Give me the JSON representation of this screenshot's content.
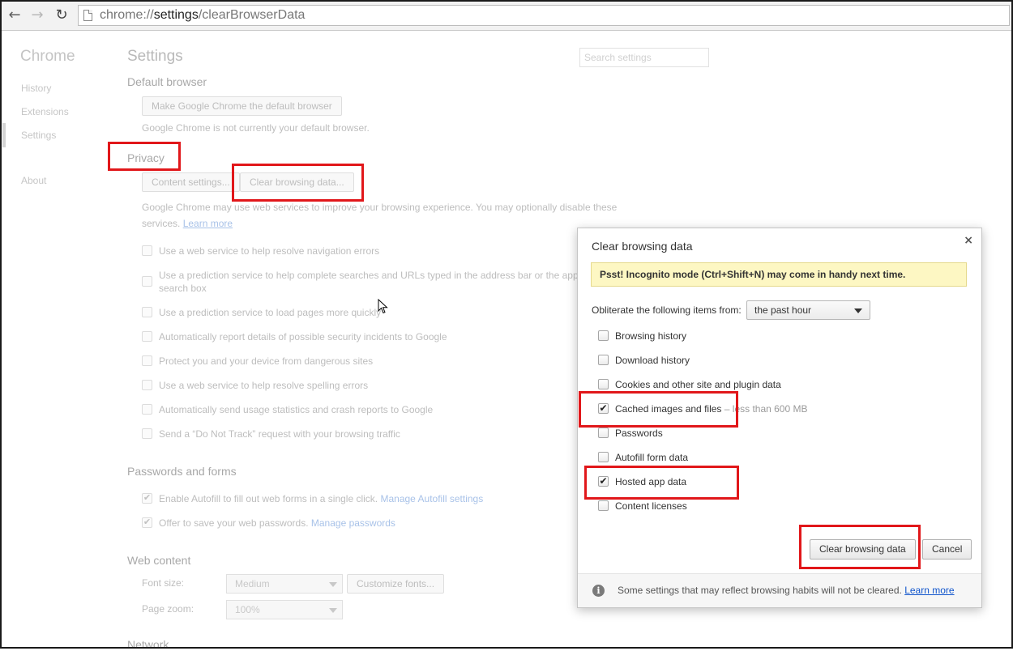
{
  "browser": {
    "url_scheme": "chrome://",
    "url_host": "settings",
    "url_path": "/clearBrowserData"
  },
  "sidebar": {
    "brand": "Chrome",
    "items": [
      {
        "label": "History"
      },
      {
        "label": "Extensions"
      },
      {
        "label": "Settings"
      },
      {
        "label": "About"
      }
    ]
  },
  "settings": {
    "title": "Settings",
    "search_placeholder": "Search settings",
    "default_browser": {
      "heading": "Default browser",
      "button": "Make Google Chrome the default browser",
      "status": "Google Chrome is not currently your default browser."
    },
    "privacy": {
      "heading": "Privacy",
      "content_settings_button": "Content settings...",
      "clear_button": "Clear browsing data...",
      "description_line1": "Google Chrome may use web services to improve your browsing experience. You may optionally disable these",
      "description_line2": "services.",
      "learn_more": "Learn more",
      "options": [
        {
          "label": "Use a web service to help resolve navigation errors",
          "checked": false
        },
        {
          "label": "Use a prediction service to help complete searches and URLs typed in the address bar or the app",
          "label2": "search box",
          "checked": false
        },
        {
          "label": "Use a prediction service to load pages more quickly",
          "checked": false
        },
        {
          "label": "Automatically report details of possible security incidents to Google",
          "checked": false
        },
        {
          "label": "Protect you and your device from dangerous sites",
          "checked": false
        },
        {
          "label": "Use a web service to help resolve spelling errors",
          "checked": false
        },
        {
          "label": "Automatically send usage statistics and crash reports to Google",
          "checked": false
        },
        {
          "label": "Send a “Do Not Track” request with your browsing traffic",
          "checked": false
        }
      ]
    },
    "passwords": {
      "heading": "Passwords and forms",
      "autofill_label": "Enable Autofill to fill out web forms in a single click.",
      "autofill_link": "Manage Autofill settings",
      "passwords_label": "Offer to save your web passwords.",
      "passwords_link": "Manage passwords"
    },
    "web_content": {
      "heading": "Web content",
      "font_size_label": "Font size:",
      "font_size_value": "Medium",
      "customize_fonts": "Customize fonts...",
      "zoom_label": "Page zoom:",
      "zoom_value": "100%"
    },
    "network": {
      "heading": "Network"
    }
  },
  "dialog": {
    "title": "Clear browsing data",
    "close": "×",
    "banner": "Psst! Incognito mode (Ctrl+Shift+N) may come in handy next time.",
    "obliterate_label": "Obliterate the following items from:",
    "time_range": "the past hour",
    "items": [
      {
        "label": "Browsing history",
        "checked": false,
        "note": ""
      },
      {
        "label": "Download history",
        "checked": false,
        "note": ""
      },
      {
        "label": "Cookies and other site and plugin data",
        "checked": false,
        "note": ""
      },
      {
        "label": "Cached images and files",
        "checked": true,
        "note": "–  less than 600 MB"
      },
      {
        "label": "Passwords",
        "checked": false,
        "note": ""
      },
      {
        "label": "Autofill form data",
        "checked": false,
        "note": ""
      },
      {
        "label": "Hosted app data",
        "checked": true,
        "note": ""
      },
      {
        "label": "Content licenses",
        "checked": false,
        "note": ""
      }
    ],
    "clear_button": "Clear browsing data",
    "cancel_button": "Cancel",
    "footer_text": "Some settings that may reflect browsing habits will not be cleared.",
    "footer_link": "Learn more",
    "check_glyph": "✔"
  },
  "colors": {
    "highlight": "#e1171a",
    "link": "#1155cc",
    "banner": "#fdf7c3"
  }
}
